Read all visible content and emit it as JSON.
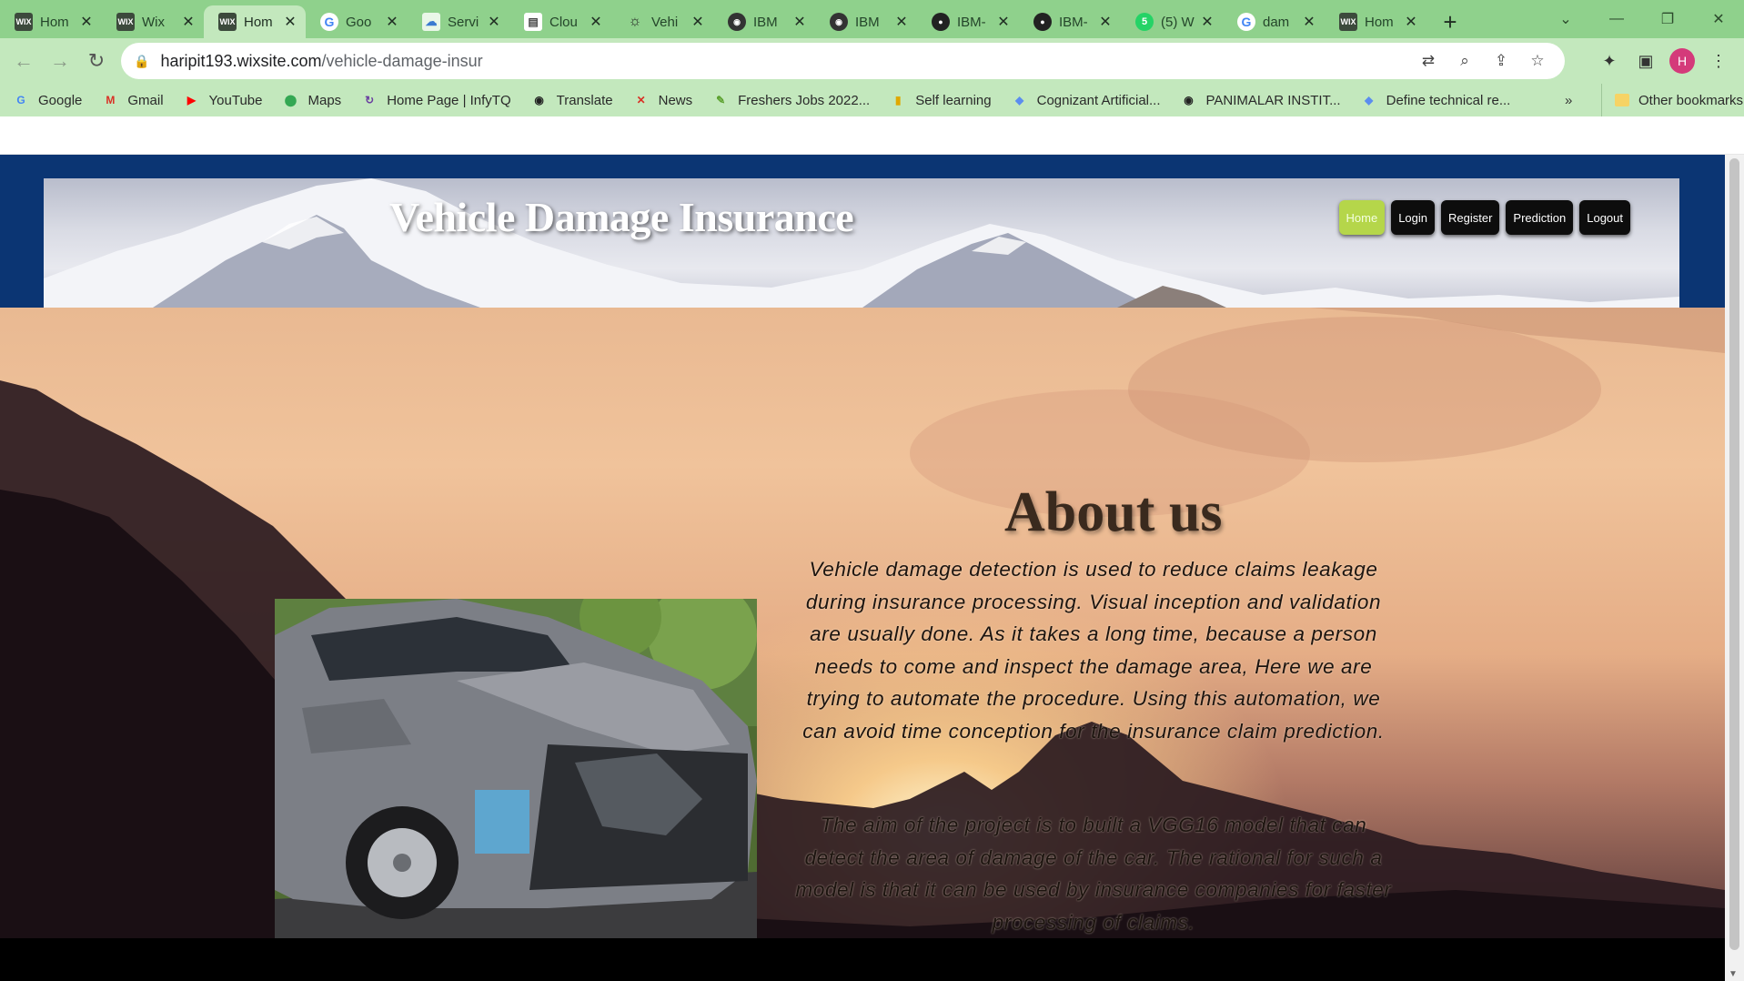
{
  "browser": {
    "tabs": [
      {
        "label": "Hom",
        "icon": "wix-icon",
        "fav": "WIX"
      },
      {
        "label": "Wix",
        "icon": "wix-icon",
        "fav": "WIX"
      },
      {
        "label": "Hom",
        "icon": "wix-icon",
        "fav": "WIX",
        "active": true
      },
      {
        "label": "Goo",
        "icon": "google-icon",
        "fav": "G"
      },
      {
        "label": "Servi",
        "icon": "cloud-icon",
        "fav": "☁"
      },
      {
        "label": "Clou",
        "icon": "document-icon",
        "fav": "▤"
      },
      {
        "label": "Vehi",
        "icon": "bulb-icon",
        "fav": "☼"
      },
      {
        "label": "IBM",
        "icon": "globe-icon",
        "fav": "◉"
      },
      {
        "label": "IBM",
        "icon": "globe-icon",
        "fav": "◉"
      },
      {
        "label": "IBM-",
        "icon": "github-icon",
        "fav": "●"
      },
      {
        "label": "IBM-",
        "icon": "github-icon",
        "fav": "●"
      },
      {
        "label": "(5) W",
        "icon": "whatsapp-icon",
        "fav": "5"
      },
      {
        "label": "dam",
        "icon": "google-icon",
        "fav": "G"
      },
      {
        "label": "Hom",
        "icon": "wix-icon",
        "fav": "WIX"
      }
    ],
    "url_host": "haripit193.wixsite.com",
    "url_path": "/vehicle-damage-insur",
    "profile_initial": "H",
    "bookmarks": [
      {
        "label": "Google",
        "icon": "google-icon",
        "glyph": "G",
        "color": "#4285f4"
      },
      {
        "label": "Gmail",
        "icon": "gmail-icon",
        "glyph": "M",
        "color": "#d93025"
      },
      {
        "label": "YouTube",
        "icon": "youtube-icon",
        "glyph": "▶",
        "color": "#ff0000"
      },
      {
        "label": "Maps",
        "icon": "maps-icon",
        "glyph": "⬤",
        "color": "#34a853"
      },
      {
        "label": "Home Page | InfyTQ",
        "icon": "infytq-icon",
        "glyph": "↻",
        "color": "#6a3fa0"
      },
      {
        "label": "Translate",
        "icon": "globe-icon",
        "glyph": "◉",
        "color": "#222222"
      },
      {
        "label": "News",
        "icon": "news-icon",
        "glyph": "✕",
        "color": "#d93025"
      },
      {
        "label": "Freshers Jobs 2022...",
        "icon": "leaf-icon",
        "glyph": "✎",
        "color": "#5aa02c"
      },
      {
        "label": "Self learning",
        "icon": "chart-icon",
        "glyph": "▮",
        "color": "#e0a800"
      },
      {
        "label": "Cognizant Artificial...",
        "icon": "diamond-icon",
        "glyph": "◆",
        "color": "#5b8def"
      },
      {
        "label": "PANIMALAR INSTIT...",
        "icon": "globe-icon",
        "glyph": "◉",
        "color": "#222222"
      },
      {
        "label": "Define technical re...",
        "icon": "diamond-icon",
        "glyph": "◆",
        "color": "#5b8def"
      }
    ],
    "bookmarks_more": "»",
    "other_bookmarks": "Other bookmarks"
  },
  "site": {
    "title": "Vehicle Damage Insurance",
    "nav": [
      "Home",
      "Login",
      "Register",
      "Prediction",
      "Logout"
    ],
    "about_heading": "About us",
    "paragraph1": "Vehicle damage detection is used to reduce claims leakage during insurance processing. Visual inception and validation are usually done. As it takes a long time, because a person needs to come and inspect the damage area, Here we are trying to automate the procedure. Using this automation, we can avoid time conception for the insurance claim prediction.",
    "paragraph2": "The aim of the project is to built a VGG16 model that can detect the area of damage of the car. The rational for such a model is that it can be used by insurance companies for faster processing of claims."
  },
  "colors": {
    "tab_strip": "#8fd18c",
    "toolbar": "#c3e8bd",
    "site_navy": "#0b3573",
    "nav_active": "#b5d64a"
  }
}
